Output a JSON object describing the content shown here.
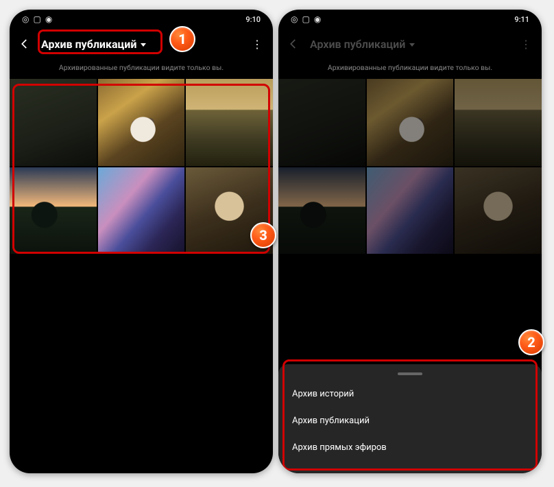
{
  "left": {
    "statusbar": {
      "time": "9:10"
    },
    "header": {
      "title": "Архив публикаций"
    },
    "subtitle": "Архивированные публикации видите только вы.",
    "grid_items": [
      {
        "name": "photo-1"
      },
      {
        "name": "photo-2"
      },
      {
        "name": "photo-3"
      },
      {
        "name": "photo-4"
      },
      {
        "name": "photo-5"
      },
      {
        "name": "photo-6"
      }
    ]
  },
  "right": {
    "statusbar": {
      "time": "9:11"
    },
    "header": {
      "title": "Архив публикаций"
    },
    "subtitle": "Архивированные публикации видите только вы.",
    "sheet": {
      "items": [
        "Архив историй",
        "Архив публикаций",
        "Архив прямых эфиров"
      ]
    }
  },
  "badges": {
    "one": "1",
    "two": "2",
    "three": "3"
  }
}
